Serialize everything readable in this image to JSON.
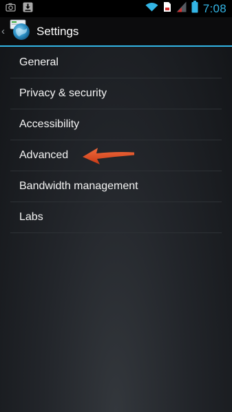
{
  "status_bar": {
    "left_icons": [
      "camera-notification-icon",
      "download-notification-icon"
    ],
    "right_icons": [
      "wifi-icon",
      "sim-card-icon",
      "signal-icon",
      "battery-icon"
    ],
    "time": "7:08",
    "accent_color": "#33b5e5"
  },
  "action_bar": {
    "title": "Settings",
    "up_icon": "back-caret-icon",
    "app_icon": "browser-globe-icon"
  },
  "settings_list": {
    "items": [
      {
        "label": "General"
      },
      {
        "label": "Privacy & security"
      },
      {
        "label": "Accessibility"
      },
      {
        "label": "Advanced"
      },
      {
        "label": "Bandwidth management"
      },
      {
        "label": "Labs"
      }
    ]
  },
  "annotation": {
    "arrow_color": "#e8542a",
    "points_to": "Advanced"
  }
}
